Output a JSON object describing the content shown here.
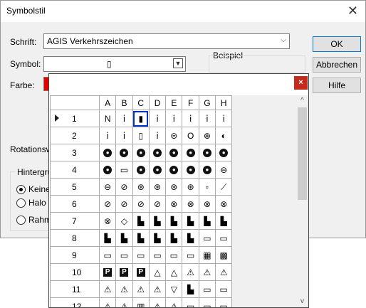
{
  "window": {
    "title": "Symbolstil",
    "close_glyph": "✕"
  },
  "labels": {
    "schrift": "Schrift:",
    "symbol": "Symbol:",
    "farbe": "Farbe:",
    "beispiel": "Beispiel",
    "rotation": "Rotationswi",
    "hintergrund": "Hintergrun"
  },
  "schrift_value": "AGIS Verkehrszeichen",
  "symbol_value": "▯",
  "buttons": {
    "ok": "OK",
    "cancel": "Abbrechen",
    "help": "Hilfe"
  },
  "radios": [
    {
      "label": "Keine",
      "checked": true
    },
    {
      "label": "Halo",
      "checked": false
    },
    {
      "label": "Rahme",
      "checked": false
    }
  ],
  "popup": {
    "close_glyph": "×",
    "columns": [
      "A",
      "B",
      "C",
      "D",
      "E",
      "F",
      "G",
      "H"
    ],
    "selected": {
      "row": 1,
      "col": "C"
    },
    "rows": [
      {
        "num": "1",
        "cells": [
          "N",
          "ⅰ",
          "▮",
          "ⅰ",
          "ⅰ",
          "ⅰ",
          "ⅰ",
          "ⅰ"
        ]
      },
      {
        "num": "2",
        "cells": [
          "ⅰ",
          "ⅰ",
          "▯",
          "ⅰ",
          "⊜",
          "O",
          "⊕",
          "◐"
        ]
      },
      {
        "num": "3",
        "cells": [
          "●",
          "●",
          "●",
          "●",
          "●",
          "●",
          "●",
          "●"
        ]
      },
      {
        "num": "4",
        "cells": [
          "●",
          "▭",
          "●",
          "●",
          "●",
          "●",
          "●",
          "⊖"
        ]
      },
      {
        "num": "5",
        "cells": [
          "⊖",
          "⊘",
          "⊛",
          "⊛",
          "⊛",
          "⊛",
          "▫",
          "⟋"
        ]
      },
      {
        "num": "6",
        "cells": [
          "⊘",
          "⊘",
          "⊘",
          "⊘",
          "⊗",
          "⊗",
          "⊗",
          "⊗"
        ]
      },
      {
        "num": "7",
        "cells": [
          "⊗",
          "◇",
          "▙",
          "▙",
          "▙",
          "▙",
          "▙",
          "▙"
        ]
      },
      {
        "num": "8",
        "cells": [
          "▙",
          "▙",
          "▙",
          "▙",
          "▙",
          "▙",
          "▭",
          "▭"
        ]
      },
      {
        "num": "9",
        "cells": [
          "▭",
          "▭",
          "▭",
          "▭",
          "▭",
          "▭",
          "▦",
          "▩"
        ]
      },
      {
        "num": "10",
        "cells": [
          "P",
          "P",
          "P",
          "△",
          "△",
          "⚠",
          "⚠",
          "⚠"
        ]
      },
      {
        "num": "11",
        "cells": [
          "⚠",
          "⚠",
          "⚠",
          "⚠",
          "▽",
          "▙",
          "▭",
          "▭"
        ]
      },
      {
        "num": "12",
        "cells": [
          "⚠",
          "⚠",
          "▥",
          "⚠",
          "⚠",
          "▭",
          "▭",
          "▭"
        ]
      }
    ]
  },
  "scroll": {
    "up": "^",
    "down": "v"
  },
  "colors": {
    "color_swatch": "#e60000",
    "selection": "#0033cc",
    "popup_close_bg": "#c42b1c"
  }
}
